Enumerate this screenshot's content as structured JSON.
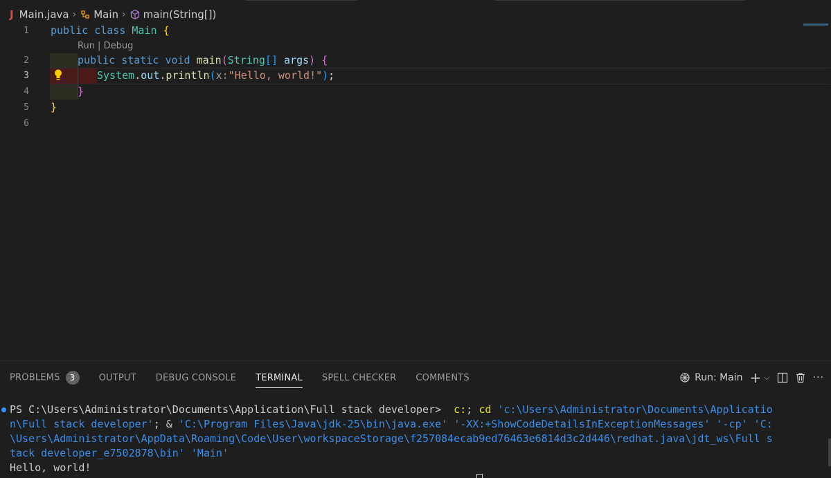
{
  "breadcrumb": {
    "file_icon": "J",
    "file": "Main.java",
    "class": "Main",
    "method": "main(String[])"
  },
  "editor": {
    "line_numbers": [
      "1",
      "2",
      "3",
      "4",
      "5",
      "6"
    ],
    "codelens": "Run | Debug",
    "line1": {
      "kw1": "public",
      "kw2": "class",
      "name": "Main",
      "brace": "{"
    },
    "line2": {
      "kw1": "public",
      "kw2": "static",
      "kw3": "void",
      "name": "main",
      "open": "(",
      "type": "String",
      "arr": "[]",
      "param": "args",
      "close": ")",
      "brace": "{"
    },
    "line3": {
      "obj": "System",
      "dot1": ".",
      "field": "out",
      "dot2": ".",
      "method": "println",
      "open": "(",
      "hint": "x:",
      "str": "\"Hello, world!\"",
      "close": ")",
      "semi": ";"
    },
    "line4": {
      "brace": "}"
    },
    "line5": {
      "brace": "}"
    }
  },
  "panel": {
    "tabs": [
      {
        "label": "PROBLEMS",
        "badge": "3"
      },
      {
        "label": "OUTPUT"
      },
      {
        "label": "DEBUG CONSOLE"
      },
      {
        "label": "TERMINAL"
      },
      {
        "label": "SPELL CHECKER"
      },
      {
        "label": "COMMENTS"
      }
    ],
    "run_label": "Run: Main",
    "icons": [
      "debug-run-icon",
      "plus-icon",
      "chevron-down-icon",
      "split-icon",
      "trash-icon",
      "more-icon"
    ]
  },
  "terminal": {
    "prompt": "PS C:\\Users\\Administrator\\Documents\\Application\\Full stack developer> ",
    "cmd1": " c:",
    "sep1": "; ",
    "cmd2": "cd",
    "path1a": " 'c:\\Users\\Administrator\\Documents\\Applicatio",
    "path1b": "n\\Full stack developer'",
    "amp": "; & ",
    "java": "'C:\\Program Files\\Java\\jdk-25\\bin\\java.exe'",
    "flag": " '-XX:+ShowCodeDetailsInExceptionMessages'",
    "cp": " '-cp'",
    "cpath1": " 'C:",
    "cpath2": "\\Users\\Administrator\\AppData\\Roaming\\Code\\User\\workspaceStorage\\f257084ecab9ed76463e6814d3c2d446\\redhat.java\\jdt_ws\\Full s",
    "cpath3": "tack developer_e7502878\\bin'",
    "main": " 'Main'",
    "output": "Hello, world!"
  },
  "colors": {
    "background": "#1e1e1e",
    "keyword": "#569cd6",
    "class": "#4ec9b0",
    "string": "#ce9178",
    "terminal_string": "#3b8eea",
    "lightbulb": "#ffcc00",
    "breakpoint_line": "#4b1818"
  }
}
